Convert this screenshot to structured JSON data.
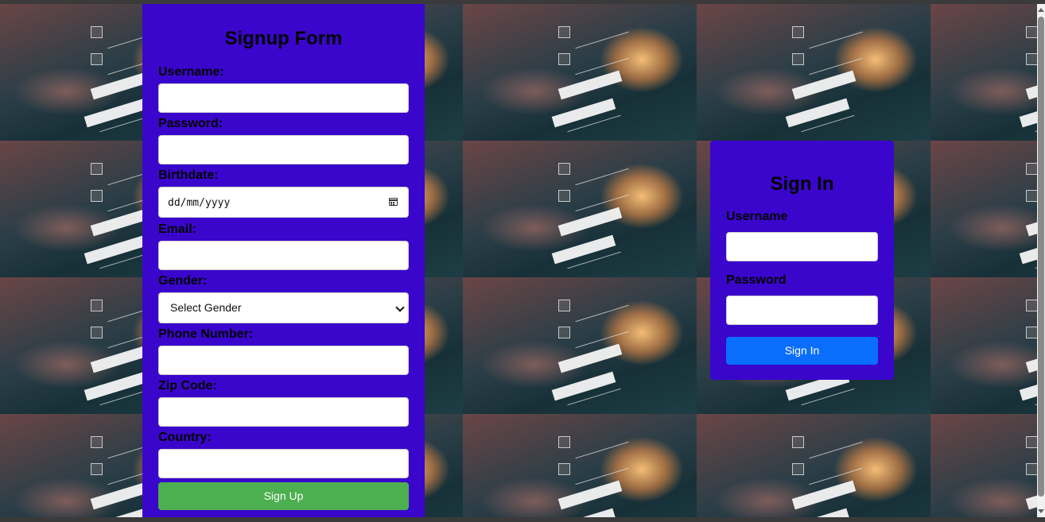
{
  "signup": {
    "title": "Signup Form",
    "labels": {
      "username": "Username:",
      "password": "Password:",
      "birthdate": "Birthdate:",
      "email": "Email:",
      "gender": "Gender:",
      "phone": "Phone Number:",
      "zip": "Zip Code:",
      "country": "Country:"
    },
    "birthdate_placeholder": "dd/mm/yyyy",
    "gender_selected": "Select Gender",
    "button": "Sign Up",
    "button_color": "#4caf50"
  },
  "signin": {
    "title": "Sign In",
    "labels": {
      "username": "Username",
      "password": "Password"
    },
    "button": "Sign In",
    "button_color": "#0a6efd"
  },
  "colors": {
    "panel": "#3a06cb"
  },
  "icons": {
    "date": "calendar-icon",
    "select": "chevron-down-icon"
  }
}
